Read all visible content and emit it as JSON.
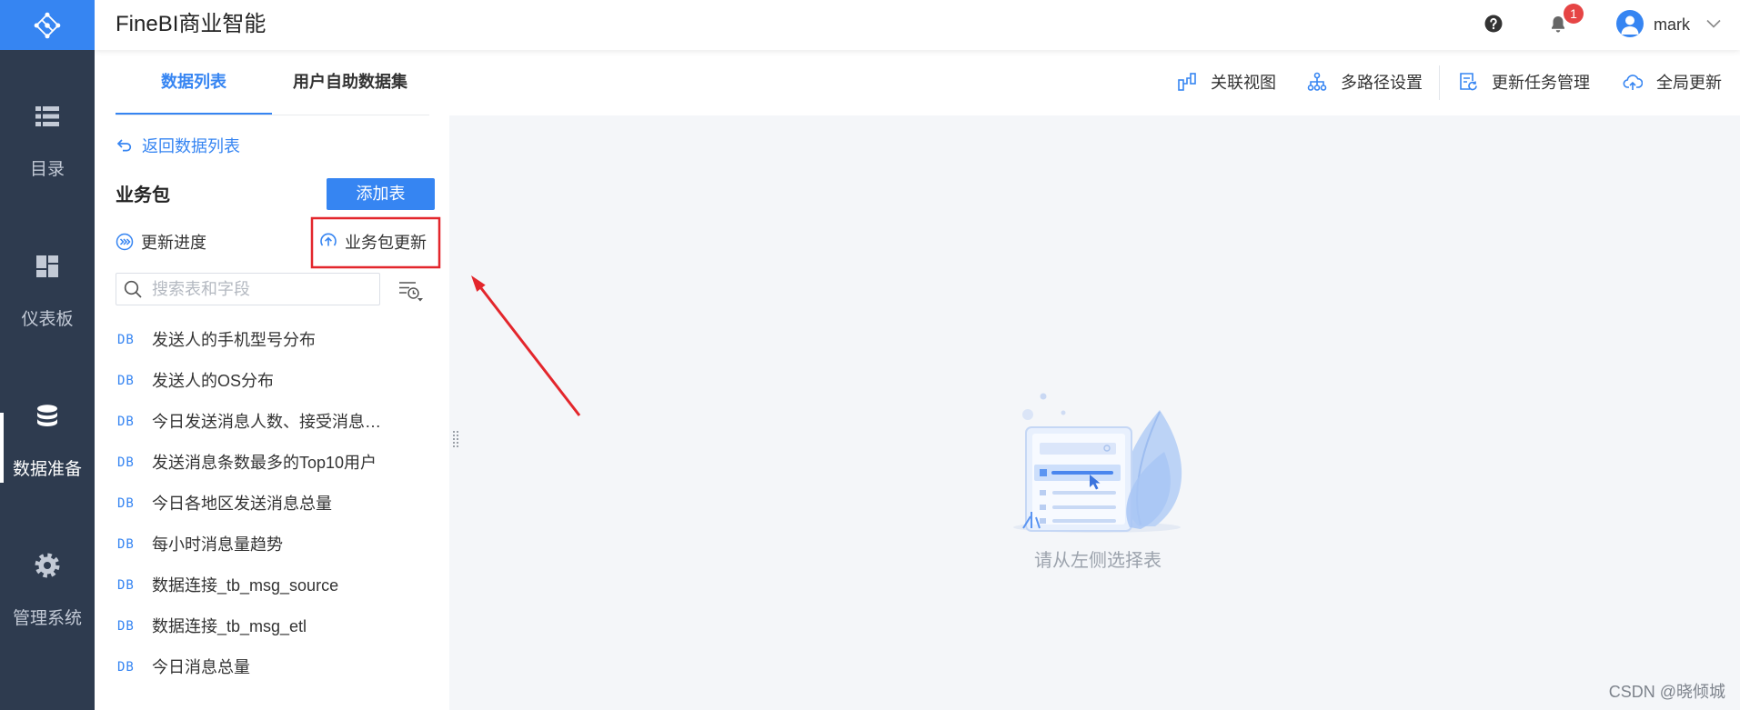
{
  "app": {
    "title": "FineBI商业智能",
    "logo_icon": "finebi-logo-icon"
  },
  "colors": {
    "brand": "#3685f2",
    "sidebar": "#2e3b4f",
    "sidebar_text": "#c3cad6",
    "main_bg": "#f4f6f9",
    "badge": "#e64545",
    "annotation": "#e3262c"
  },
  "sidebar": {
    "items": [
      {
        "label": "目录",
        "icon": "list-icon",
        "active": false
      },
      {
        "label": "仪表板",
        "icon": "dashboard-icon",
        "active": false
      },
      {
        "label": "数据准备",
        "icon": "database-icon",
        "active": true
      },
      {
        "label": "管理系统",
        "icon": "gear-icon",
        "active": false
      }
    ]
  },
  "header": {
    "help_icon": "help-icon",
    "notifications": {
      "icon": "bell-icon",
      "count": "1"
    },
    "user": {
      "name": "mark",
      "avatar_icon": "user-icon",
      "menu_icon": "chevron-down-icon"
    }
  },
  "tabs": [
    {
      "label": "数据列表",
      "active": true
    },
    {
      "label": "用户自助数据集",
      "active": false
    }
  ],
  "toolbar": [
    {
      "label": "关联视图",
      "icon": "relation-view-icon"
    },
    {
      "label": "多路径设置",
      "icon": "multi-path-icon"
    },
    {
      "label": "更新任务管理",
      "icon": "task-manage-icon"
    },
    {
      "label": "全局更新",
      "icon": "cloud-refresh-icon"
    }
  ],
  "panel": {
    "back_label": "返回数据列表",
    "back_icon": "back-arrow-icon",
    "package_title": "业务包",
    "add_table_label": "添加表",
    "progress_label": "更新进度",
    "progress_icon": "progress-icon",
    "package_update_label": "业务包更新",
    "package_update_icon": "upload-circle-icon",
    "search_placeholder": "搜索表和字段",
    "search_icon": "search-icon",
    "filter_icon": "filter-history-icon",
    "table_tag": "DB",
    "tables": [
      "发送人的手机型号分布",
      "发送人的OS分布",
      "今日发送消息人数、接受消息…",
      "发送消息条数最多的Top10用户",
      "今日各地区发送消息总量",
      "每小时消息量趋势",
      "数据连接_tb_msg_source",
      "数据连接_tb_msg_etl",
      "今日消息总量"
    ]
  },
  "main": {
    "empty_text": "请从左侧选择表",
    "illustration": "empty-table-illustration"
  },
  "watermark": "CSDN @晓倾城"
}
